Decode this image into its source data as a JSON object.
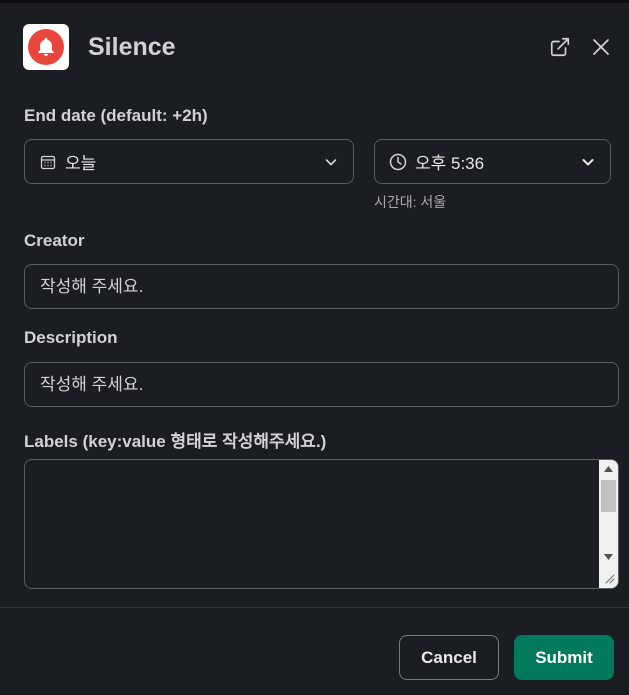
{
  "header": {
    "title": "Silence",
    "app_icon": "bell-icon",
    "expand_icon": "external-link-icon",
    "close_icon": "close-icon",
    "brand_color": "#e8453c"
  },
  "end_date": {
    "label": "End date (default: +2h)",
    "date_value": "오늘",
    "date_icon": "calendar-icon",
    "time_value": "오후 5:36",
    "time_icon": "clock-icon",
    "timezone": "시간대: 서울"
  },
  "creator": {
    "label": "Creator",
    "placeholder": "작성해 주세요."
  },
  "description": {
    "label": "Description",
    "placeholder": "작성해 주세요."
  },
  "labels": {
    "label": "Labels (key:value 형태로 작성해주세요.)",
    "value": ""
  },
  "footer": {
    "cancel_label": "Cancel",
    "submit_label": "Submit",
    "submit_color": "#007a5a"
  }
}
